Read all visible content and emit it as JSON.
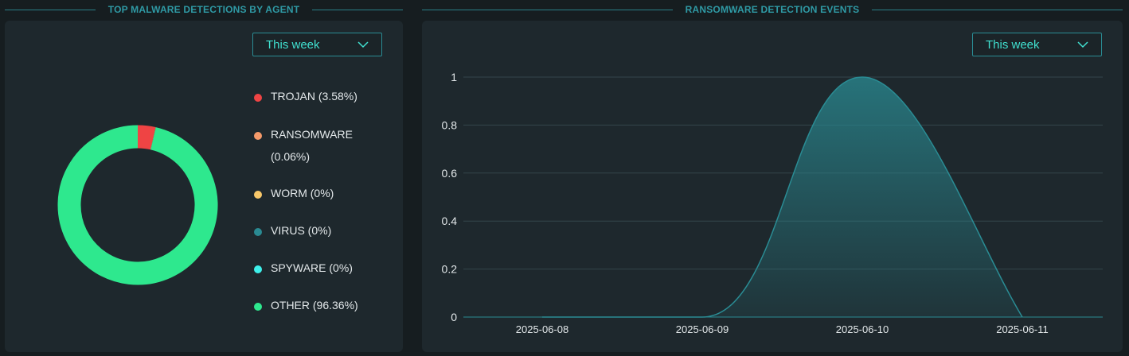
{
  "left_panel": {
    "title": "TOP MALWARE DETECTIONS BY AGENT",
    "dropdown": {
      "value": "This week"
    }
  },
  "right_panel": {
    "title": "RANSOMWARE DETECTION EVENTS",
    "dropdown": {
      "value": "This week"
    }
  },
  "chart_data": [
    {
      "type": "pie",
      "variant": "donut",
      "title": "TOP MALWARE DETECTIONS BY AGENT",
      "legend_position": "right",
      "slices": [
        {
          "label": "TROJAN (3.58%)",
          "value": 3.58,
          "color": "#ef4444"
        },
        {
          "label": "RANSOMWARE (0.06%)",
          "value": 0.06,
          "color": "#f59a6a"
        },
        {
          "label": "WORM (0%)",
          "value": 0,
          "color": "#f8c86a"
        },
        {
          "label": "VIRUS (0%)",
          "value": 0,
          "color": "#2a8a92"
        },
        {
          "label": "SPYWARE (0%)",
          "value": 0,
          "color": "#3ef0ea"
        },
        {
          "label": "OTHER (96.36%)",
          "value": 96.36,
          "color": "#2ee88e"
        }
      ]
    },
    {
      "type": "area",
      "title": "RANSOMWARE DETECTION EVENTS",
      "x_ticks": [
        "2025-06-08",
        "2025-06-09",
        "2025-06-10",
        "2025-06-11"
      ],
      "y_ticks": [
        "0",
        "0.2",
        "0.4",
        "0.6",
        "0.8",
        "1"
      ],
      "ylim": [
        0,
        1
      ],
      "grid": true,
      "series": [
        {
          "color": "#2a8c94",
          "points": [
            {
              "x": "2025-06-08",
              "y": 0
            },
            {
              "x": "2025-06-09",
              "y": 0
            },
            {
              "x": "2025-06-10",
              "y": 1
            },
            {
              "x": "2025-06-11",
              "y": 0
            }
          ]
        }
      ]
    }
  ]
}
